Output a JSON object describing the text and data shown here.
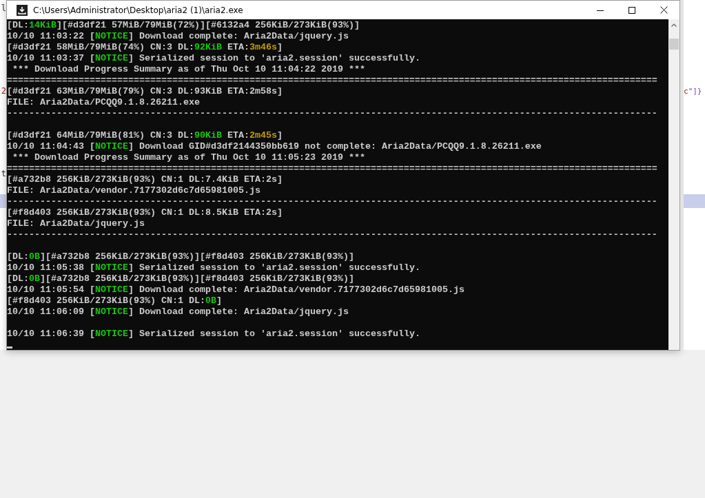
{
  "editor_behind": {
    "rows": [
      {
        "highlighted": false,
        "left": [
          {
            "text": "l",
            "kind": "plain"
          }
        ]
      },
      {
        "highlighted": false
      },
      {
        "highlighted": false
      },
      {
        "highlighted": false
      },
      {
        "highlighted": false
      },
      {
        "highlighted": false
      },
      {
        "highlighted": false,
        "left": [
          {
            "text": "2",
            "kind": "string"
          }
        ],
        "right": [
          {
            "text": "c",
            "kind": "string"
          },
          {
            "text": "\"]}",
            "kind": "bracket"
          }
        ]
      },
      {
        "highlighted": false
      },
      {
        "highlighted": false
      },
      {
        "highlighted": false
      },
      {
        "highlighted": false
      },
      {
        "highlighted": false
      },
      {
        "highlighted": false,
        "left": [
          {
            "text": "t",
            "kind": "plain"
          }
        ]
      },
      {
        "highlighted": false
      },
      {
        "highlighted": true
      }
    ]
  },
  "window": {
    "title": "C:\\Users\\Administrator\\Desktop\\aria2 (1)\\aria2.exe",
    "console": {
      "lines": [
        {
          "kind": "text",
          "segments": [
            {
              "text": "[DL:"
            },
            {
              "text": "14KiB",
              "color": "#16c60c"
            },
            {
              "text": "][#d3df21 57MiB/79MiB(72%)][#6132a4 256KiB/273KiB(93%)]"
            }
          ]
        },
        {
          "kind": "text",
          "segments": [
            {
              "text": "10/10 11:03:22 ["
            },
            {
              "text": "NOTICE",
              "color": "#16c60c"
            },
            {
              "text": "] Download complete: Aria2Data/jquery.js"
            }
          ]
        },
        {
          "kind": "text",
          "segments": [
            {
              "text": "[#d3df21 58MiB/79MiB(74%) CN:3 DL:"
            },
            {
              "text": "92KiB",
              "color": "#16c60c"
            },
            {
              "text": " ETA:"
            },
            {
              "text": "3m46s",
              "color": "#c19c00"
            },
            {
              "text": "]"
            }
          ]
        },
        {
          "kind": "text",
          "segments": [
            {
              "text": "10/10 11:03:37 ["
            },
            {
              "text": "NOTICE",
              "color": "#16c60c"
            },
            {
              "text": "] Serialized session to 'aria2.session' successfully."
            }
          ]
        },
        {
          "kind": "text",
          "segments": [
            {
              "text": " *** Download Progress Summary as of Thu Oct 10 11:04:22 2019 ***"
            }
          ]
        },
        {
          "kind": "rule",
          "text": "======================================================================================================================"
        },
        {
          "kind": "text",
          "segments": [
            {
              "text": "[#d3df21 63MiB/79MiB(79%) CN:3 DL:93KiB ETA:2m58s]"
            }
          ]
        },
        {
          "kind": "text",
          "segments": [
            {
              "text": "FILE: Aria2Data/PCQQ9.1.8.26211.exe"
            }
          ]
        },
        {
          "kind": "rule",
          "text": "----------------------------------------------------------------------------------------------------------------------"
        },
        {
          "kind": "blank"
        },
        {
          "kind": "text",
          "segments": [
            {
              "text": "[#d3df21 64MiB/79MiB(81%) CN:3 DL:"
            },
            {
              "text": "90KiB",
              "color": "#16c60c"
            },
            {
              "text": " ETA:"
            },
            {
              "text": "2m45s",
              "color": "#c19c00"
            },
            {
              "text": "]"
            }
          ]
        },
        {
          "kind": "text",
          "segments": [
            {
              "text": "10/10 11:04:43 ["
            },
            {
              "text": "NOTICE",
              "color": "#16c60c"
            },
            {
              "text": "] Download GID#d3df2144350bb619 not complete: Aria2Data/PCQQ9.1.8.26211.exe"
            }
          ]
        },
        {
          "kind": "text",
          "segments": [
            {
              "text": " *** Download Progress Summary as of Thu Oct 10 11:05:23 2019 ***"
            }
          ]
        },
        {
          "kind": "rule",
          "text": "======================================================================================================================"
        },
        {
          "kind": "text",
          "segments": [
            {
              "text": "[#a732b8 256KiB/273KiB(93%) CN:1 DL:7.4KiB ETA:2s]"
            }
          ]
        },
        {
          "kind": "text",
          "segments": [
            {
              "text": "FILE: Aria2Data/vendor.7177302d6c7d65981005.js"
            }
          ]
        },
        {
          "kind": "rule",
          "text": "----------------------------------------------------------------------------------------------------------------------"
        },
        {
          "kind": "text",
          "segments": [
            {
              "text": "[#f8d403 256KiB/273KiB(93%) CN:1 DL:8.5KiB ETA:2s]"
            }
          ]
        },
        {
          "kind": "text",
          "segments": [
            {
              "text": "FILE: Aria2Data/jquery.js"
            }
          ]
        },
        {
          "kind": "rule",
          "text": "----------------------------------------------------------------------------------------------------------------------"
        },
        {
          "kind": "blank"
        },
        {
          "kind": "text",
          "segments": [
            {
              "text": "[DL:"
            },
            {
              "text": "0B",
              "color": "#16c60c"
            },
            {
              "text": "][#a732b8 256KiB/273KiB(93%)][#f8d403 256KiB/273KiB(93%)]"
            }
          ]
        },
        {
          "kind": "text",
          "segments": [
            {
              "text": "10/10 11:05:38 ["
            },
            {
              "text": "NOTICE",
              "color": "#16c60c"
            },
            {
              "text": "] Serialized session to 'aria2.session' successfully."
            }
          ]
        },
        {
          "kind": "text",
          "segments": [
            {
              "text": "[DL:"
            },
            {
              "text": "0B",
              "color": "#16c60c"
            },
            {
              "text": "][#a732b8 256KiB/273KiB(93%)][#f8d403 256KiB/273KiB(93%)]"
            }
          ]
        },
        {
          "kind": "text",
          "segments": [
            {
              "text": "10/10 11:05:54 ["
            },
            {
              "text": "NOTICE",
              "color": "#16c60c"
            },
            {
              "text": "] Download complete: Aria2Data/vendor.7177302d6c7d65981005.js"
            }
          ]
        },
        {
          "kind": "text",
          "segments": [
            {
              "text": "[#f8d403 256KiB/273KiB(93%) CN:1 DL:"
            },
            {
              "text": "0B",
              "color": "#16c60c"
            },
            {
              "text": "]"
            }
          ]
        },
        {
          "kind": "text",
          "segments": [
            {
              "text": "10/10 11:06:09 ["
            },
            {
              "text": "NOTICE",
              "color": "#16c60c"
            },
            {
              "text": "] Download complete: Aria2Data/jquery.js"
            }
          ]
        },
        {
          "kind": "blank"
        },
        {
          "kind": "text",
          "segments": [
            {
              "text": "10/10 11:06:39 ["
            },
            {
              "text": "NOTICE",
              "color": "#16c60c"
            },
            {
              "text": "] Serialized session to 'aria2.session' successfully."
            }
          ]
        },
        {
          "kind": "cursor"
        }
      ]
    }
  }
}
